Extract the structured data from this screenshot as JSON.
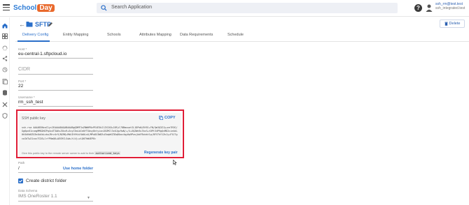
{
  "topbar": {
    "logo_school": "School",
    "logo_day": "Day",
    "search_placeholder": "Search Application",
    "help_glyph": "?",
    "user_name": "ssh_rm@test.test",
    "user_sub": "ssh_integrated.test"
  },
  "header": {
    "back_glyph": "←",
    "title": "SFTP",
    "delete_label": "Delete"
  },
  "tabs": [
    {
      "label": "Delivery Config",
      "active": true
    },
    {
      "label": "Entity Mapping",
      "active": false
    },
    {
      "label": "Schools",
      "active": false
    },
    {
      "label": "Attributes Mapping",
      "active": false
    },
    {
      "label": "Data Requirements",
      "active": false
    },
    {
      "label": "Schedule",
      "active": false
    }
  ],
  "form": {
    "host_label": "Host *",
    "host_value": "eu-central-1.sftpcloud.io",
    "cidr_placeholder": "CIDR",
    "port_label": "Port *",
    "port_value": "22",
    "username_label": "Username *",
    "username_value": "rm_ssh_test",
    "ssh_label": "SSH public key",
    "copy_label": "COPY",
    "ssh_key": "ssh-rsa AAAAB3NzaC1yc2EAAAADAQABAAABgQDMF3uZNWHP0zPE4E5k2lZXI4D+1BFyl78BmxuatIL1DPoN/Bf8l+FN/Qm3Q3ZJy+ne7R3G/Gg6pn61cvmgMMGDHZPq4x4T3A6sJ5kcR+5xyC5mLbCe0fTXbsy8ntyixnJ8ZMCl3c0Jgz9wN/+/X+3QZWe3u7bzS+tDPt34P9gQvMD2cie4dL0h5kRd8ZU3e4b4bLvbuJRrz4r9/N2MQ+MkUIHfKsV4b0LnU/MPwDX3WQ9+EbqbKZ3DqRAoc4qy0q9PwvjbkFBcbkt1p/8FV7kY1ZnJy+F5J7gcaIdTw21cocTCOS+lrfP0mQK+AEG9CLSwb+Y+Vj+vLQH7hW4EP8="
  },
  "ssh_hint": {
    "text": "Give this public key to the remote server owner to add to their",
    "code": "authorized_keys",
    "regenerate_label": "Regenerate key pair"
  },
  "path": {
    "label": "Path",
    "value": "/",
    "use_home_label": "Use home folder"
  },
  "district": {
    "checked": true,
    "label": "Create district folder"
  },
  "schema": {
    "label": "Data Schema",
    "value": "IMS OneRoster 1.1"
  },
  "colors": {
    "accent": "#2a6fc9",
    "highlight_border": "#e01e37",
    "logo_orange": "#e9692c"
  }
}
